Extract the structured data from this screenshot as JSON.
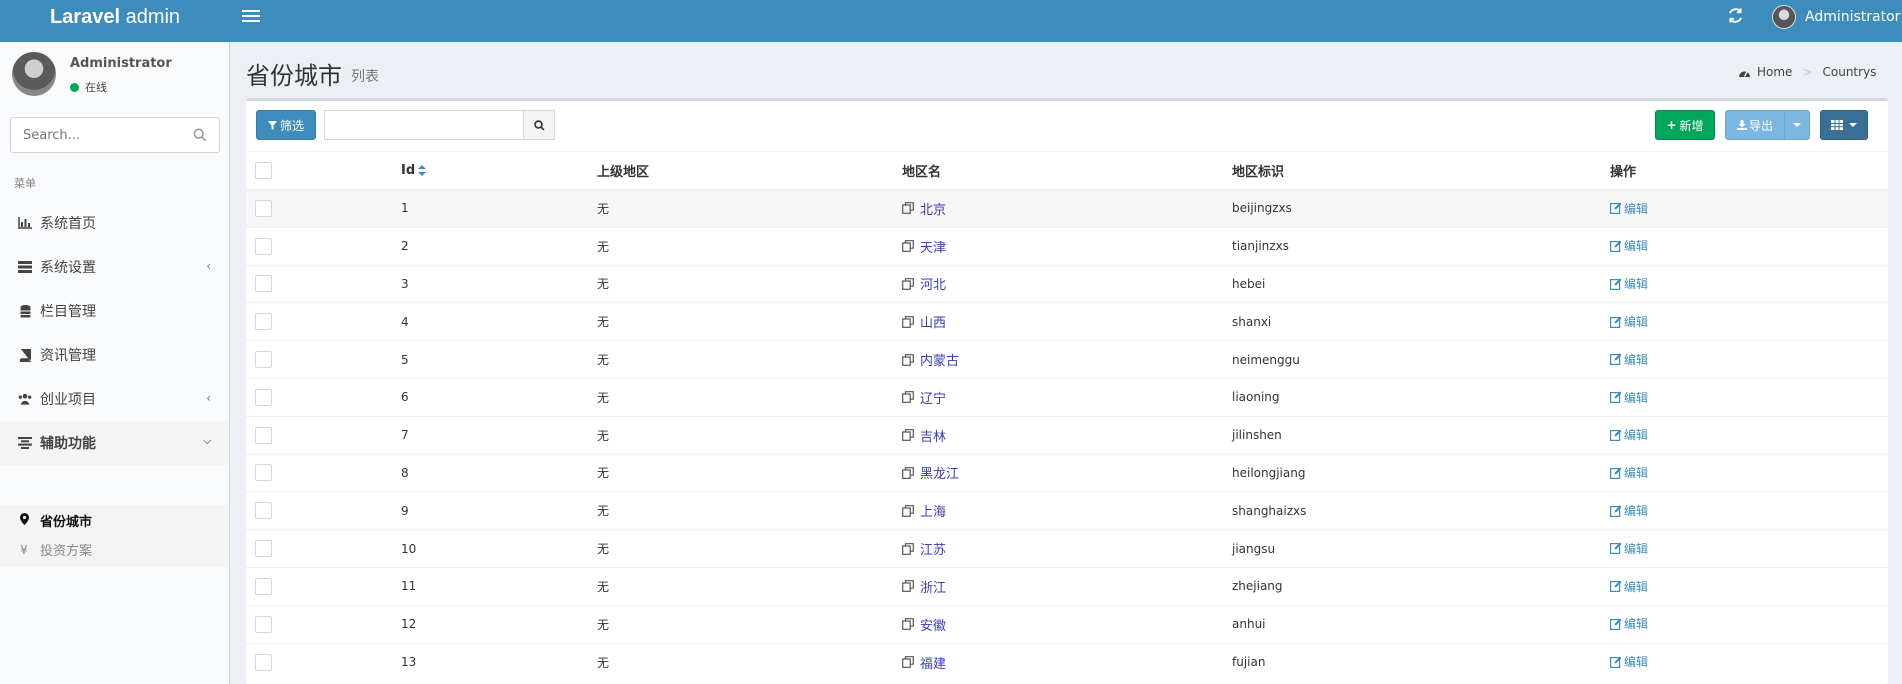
{
  "header": {
    "logo_bold": "Laravel",
    "logo_rest": " admin",
    "user_name": "Administrator"
  },
  "sidebar": {
    "user_name": "Administrator",
    "user_status": "在线",
    "search_placeholder": "Search...",
    "menu_header": "菜单",
    "items": [
      {
        "label": "系统首页",
        "icon": "bar-chart-icon"
      },
      {
        "label": "系统设置",
        "icon": "tasks-icon",
        "has_children": true
      },
      {
        "label": "栏目管理",
        "icon": "database-icon"
      },
      {
        "label": "资讯管理",
        "icon": "book-icon"
      },
      {
        "label": "创业项目",
        "icon": "users-icon",
        "has_children": true
      },
      {
        "label": "辅助功能",
        "icon": "align-center-icon",
        "has_children": true,
        "open": true
      }
    ],
    "sub_items": [
      {
        "label": "省份城市",
        "icon": "map-marker-icon",
        "active": true
      },
      {
        "label": "投资方案",
        "icon": "yen-icon",
        "active": false
      }
    ]
  },
  "page": {
    "title": "省份城市",
    "subtitle": "列表",
    "breadcrumb": {
      "home": "Home",
      "current": "Countrys"
    }
  },
  "toolbar": {
    "filter_label": "筛选",
    "new_label": "新增",
    "export_label": "导出"
  },
  "table": {
    "columns": [
      "Id",
      "上级地区",
      "地区名",
      "地区标识",
      "操作"
    ],
    "edit_label": "编辑",
    "rows": [
      {
        "id": "1",
        "parent": "无",
        "name": "北京",
        "code": "beijingzxs"
      },
      {
        "id": "2",
        "parent": "无",
        "name": "天津",
        "code": "tianjinzxs"
      },
      {
        "id": "3",
        "parent": "无",
        "name": "河北",
        "code": "hebei"
      },
      {
        "id": "4",
        "parent": "无",
        "name": "山西",
        "code": "shanxi"
      },
      {
        "id": "5",
        "parent": "无",
        "name": "内蒙古",
        "code": "neimenggu"
      },
      {
        "id": "6",
        "parent": "无",
        "name": "辽宁",
        "code": "liaoning"
      },
      {
        "id": "7",
        "parent": "无",
        "name": "吉林",
        "code": "jilinshen"
      },
      {
        "id": "8",
        "parent": "无",
        "name": "黑龙江",
        "code": "heilongjiang"
      },
      {
        "id": "9",
        "parent": "无",
        "name": "上海",
        "code": "shanghaizxs"
      },
      {
        "id": "10",
        "parent": "无",
        "name": "江苏",
        "code": "jiangsu"
      },
      {
        "id": "11",
        "parent": "无",
        "name": "浙江",
        "code": "zhejiang"
      },
      {
        "id": "12",
        "parent": "无",
        "name": "安徽",
        "code": "anhui"
      },
      {
        "id": "13",
        "parent": "无",
        "name": "福建",
        "code": "fujian"
      }
    ]
  },
  "colors": {
    "header": "#3c8dbc",
    "success": "#00a65a",
    "link": "#3c8dbc"
  }
}
